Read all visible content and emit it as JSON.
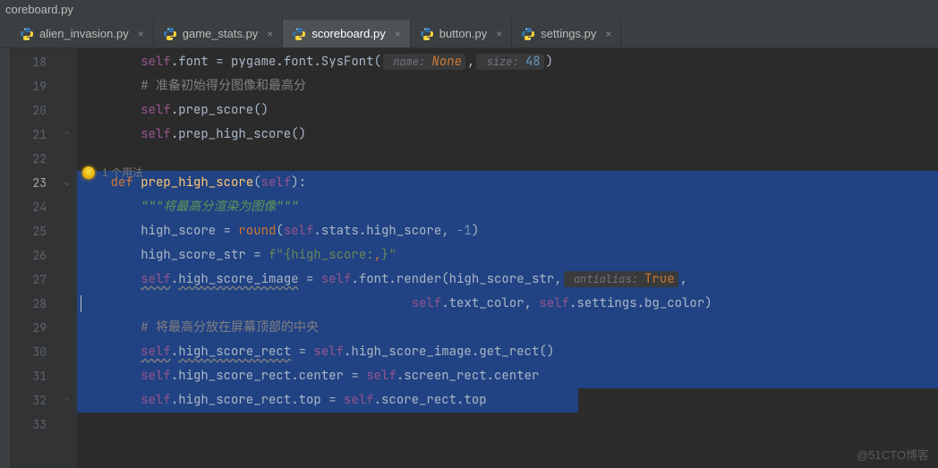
{
  "title": "coreboard.py",
  "tabs": [
    {
      "label": "alien_invasion.py",
      "active": false
    },
    {
      "label": "game_stats.py",
      "active": false
    },
    {
      "label": "scoreboard.py",
      "active": true
    },
    {
      "label": "button.py",
      "active": false
    },
    {
      "label": "settings.py",
      "active": false
    }
  ],
  "usages_hint": "1 个用法",
  "watermark": "@51CTO博客",
  "gutter": {
    "start": 18,
    "end": 33,
    "current": 23
  },
  "code": {
    "l18": {
      "self": "self",
      "font_attr": ".font = pygame.font.SysFont(",
      "p1": " name: ",
      "v1": "None",
      "comma": ",",
      "p2": " size: ",
      "v2": "48",
      "close": ")"
    },
    "l19": {
      "cmt": "# 准备初始得分图像和最高分"
    },
    "l20": {
      "self": "self",
      "call": ".prep_score()"
    },
    "l21": {
      "self": "self",
      "call": ".prep_high_score()"
    },
    "l23": {
      "def": "def ",
      "name": "prep_high_score",
      "open": "(",
      "self": "self",
      "close": "):"
    },
    "l24": {
      "doc": "\"\"\"将最高分渲染为图像\"\"\""
    },
    "l25": {
      "a": "high_score = ",
      "round": "round",
      "b": "(",
      "self": "self",
      "c": ".stats.high_score, ",
      "n": "-1",
      "d": ")"
    },
    "l26": {
      "a": "high_score_str = ",
      "fs": "f\"",
      "b": "{high_score:",
      "comma": ",",
      "c": "}",
      "fe": "\""
    },
    "l27": {
      "self1": "self",
      "a": ".",
      "hsi": "high_score_image",
      "b": " = ",
      "self2": "self",
      "c": ".font.render(high_score_str,",
      "p": " antialias: ",
      "v": "True",
      "d": ","
    },
    "l28": {
      "self1": "self",
      "a": ".text_color, ",
      "self2": "self",
      "b": ".settings.bg_color)"
    },
    "l29": {
      "cmt": "# 将最高分放在屏幕顶部的中央"
    },
    "l30": {
      "self1": "self",
      "a": ".",
      "hsr": "high_score_rect",
      "b": " = ",
      "self2": "self",
      "c": ".high_score_image.get_rect()"
    },
    "l31": {
      "self1": "self",
      "a": ".high_score_rect.center = ",
      "self2": "self",
      "b": ".screen_rect.center"
    },
    "l32": {
      "self1": "self",
      "a": ".high_score_rect.top = ",
      "self2": "self",
      "b": ".score_rect.top"
    }
  }
}
